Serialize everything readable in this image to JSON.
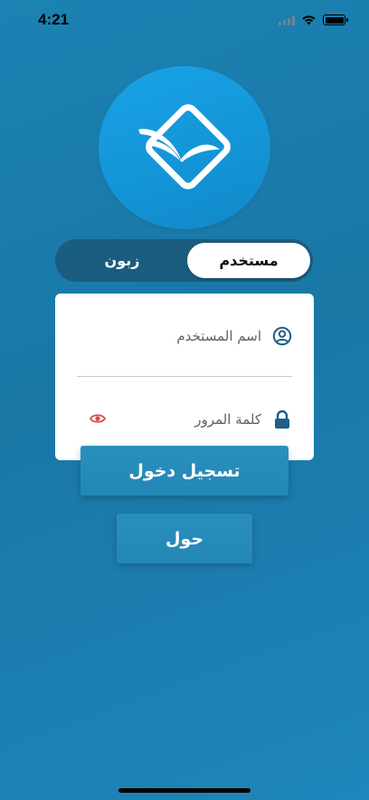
{
  "status": {
    "time": "4:21"
  },
  "logo": {
    "alt": "app-logo"
  },
  "toggle": {
    "active_label": "مستخدم",
    "inactive_label": "زبون"
  },
  "form": {
    "username_placeholder": "اسم المستخدم",
    "username_value": "",
    "password_placeholder": "كلمة المرور",
    "password_value": ""
  },
  "buttons": {
    "login_label": "تسجيل دخول",
    "about_label": "حول"
  },
  "colors": {
    "background": "#1a7cab",
    "logo_bg": "#1596d8",
    "toggle_bg": "#1a5d7e",
    "icon": "#1f5f86",
    "eye": "#e04848"
  }
}
